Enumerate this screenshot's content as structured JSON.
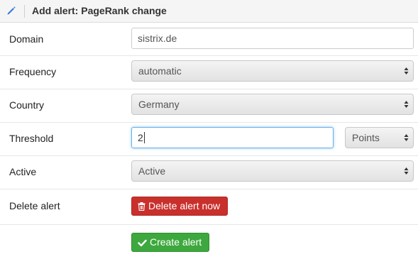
{
  "header": {
    "title": "Add alert: PageRank change",
    "icon": "pencil-icon"
  },
  "fields": {
    "domain": {
      "label": "Domain",
      "value": "sistrix.de"
    },
    "frequency": {
      "label": "Frequency",
      "selected": "automatic"
    },
    "country": {
      "label": "Country",
      "selected": "Germany"
    },
    "threshold": {
      "label": "Threshold",
      "value": "2",
      "unit_selected": "Points"
    },
    "active": {
      "label": "Active",
      "selected": "Active"
    },
    "delete": {
      "label": "Delete alert",
      "button_label": "Delete alert now"
    }
  },
  "actions": {
    "create_label": "Create alert"
  },
  "colors": {
    "danger": "#c9302c",
    "success": "#3da83d",
    "focus": "#66afe9"
  }
}
